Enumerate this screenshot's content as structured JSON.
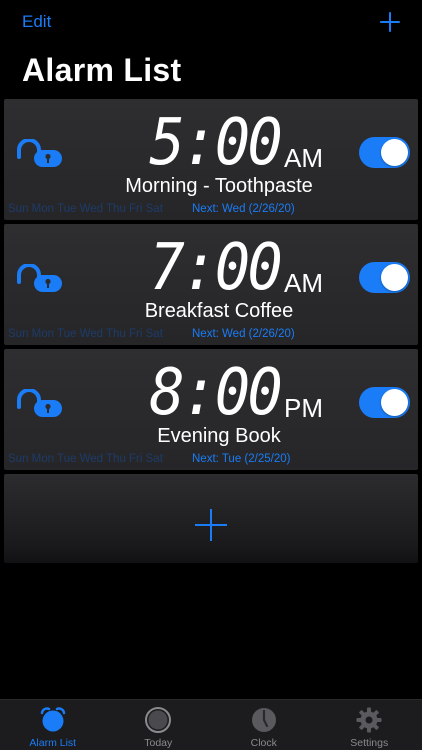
{
  "nav": {
    "edit_label": "Edit",
    "add_icon": "plus-icon",
    "title": "Alarm List"
  },
  "alarms": [
    {
      "time": "5:00",
      "ampm": "AM",
      "label": "Morning - Toothpaste",
      "days": "Sun Mon Tue Wed Thu Fri Sat",
      "next": "Next: Wed (2/26/20)",
      "enabled": true,
      "lock_icon": "unlocked-padlock-icon"
    },
    {
      "time": "7:00",
      "ampm": "AM",
      "label": "Breakfast Coffee",
      "days": "Sun Mon Tue Wed Thu Fri Sat",
      "next": "Next: Wed (2/26/20)",
      "enabled": true,
      "lock_icon": "unlocked-padlock-icon"
    },
    {
      "time": "8:00",
      "ampm": "PM",
      "label": "Evening Book",
      "days": "Sun Mon Tue Wed Thu Fri Sat",
      "next": "Next: Tue (2/25/20)",
      "enabled": true,
      "lock_icon": "unlocked-padlock-icon"
    }
  ],
  "tabs": [
    {
      "label": "Alarm List",
      "icon": "alarm-clock-icon",
      "active": true
    },
    {
      "label": "Today",
      "icon": "circle-icon",
      "active": false
    },
    {
      "label": "Clock",
      "icon": "clock-icon",
      "active": false
    },
    {
      "label": "Settings",
      "icon": "gear-icon",
      "active": false
    }
  ],
  "colors": {
    "accent": "#1a7cf6",
    "background": "#000000",
    "card": "#2c2c2e",
    "days_dim": "#1d3b6a",
    "tab_inactive": "#8a8a8e"
  }
}
